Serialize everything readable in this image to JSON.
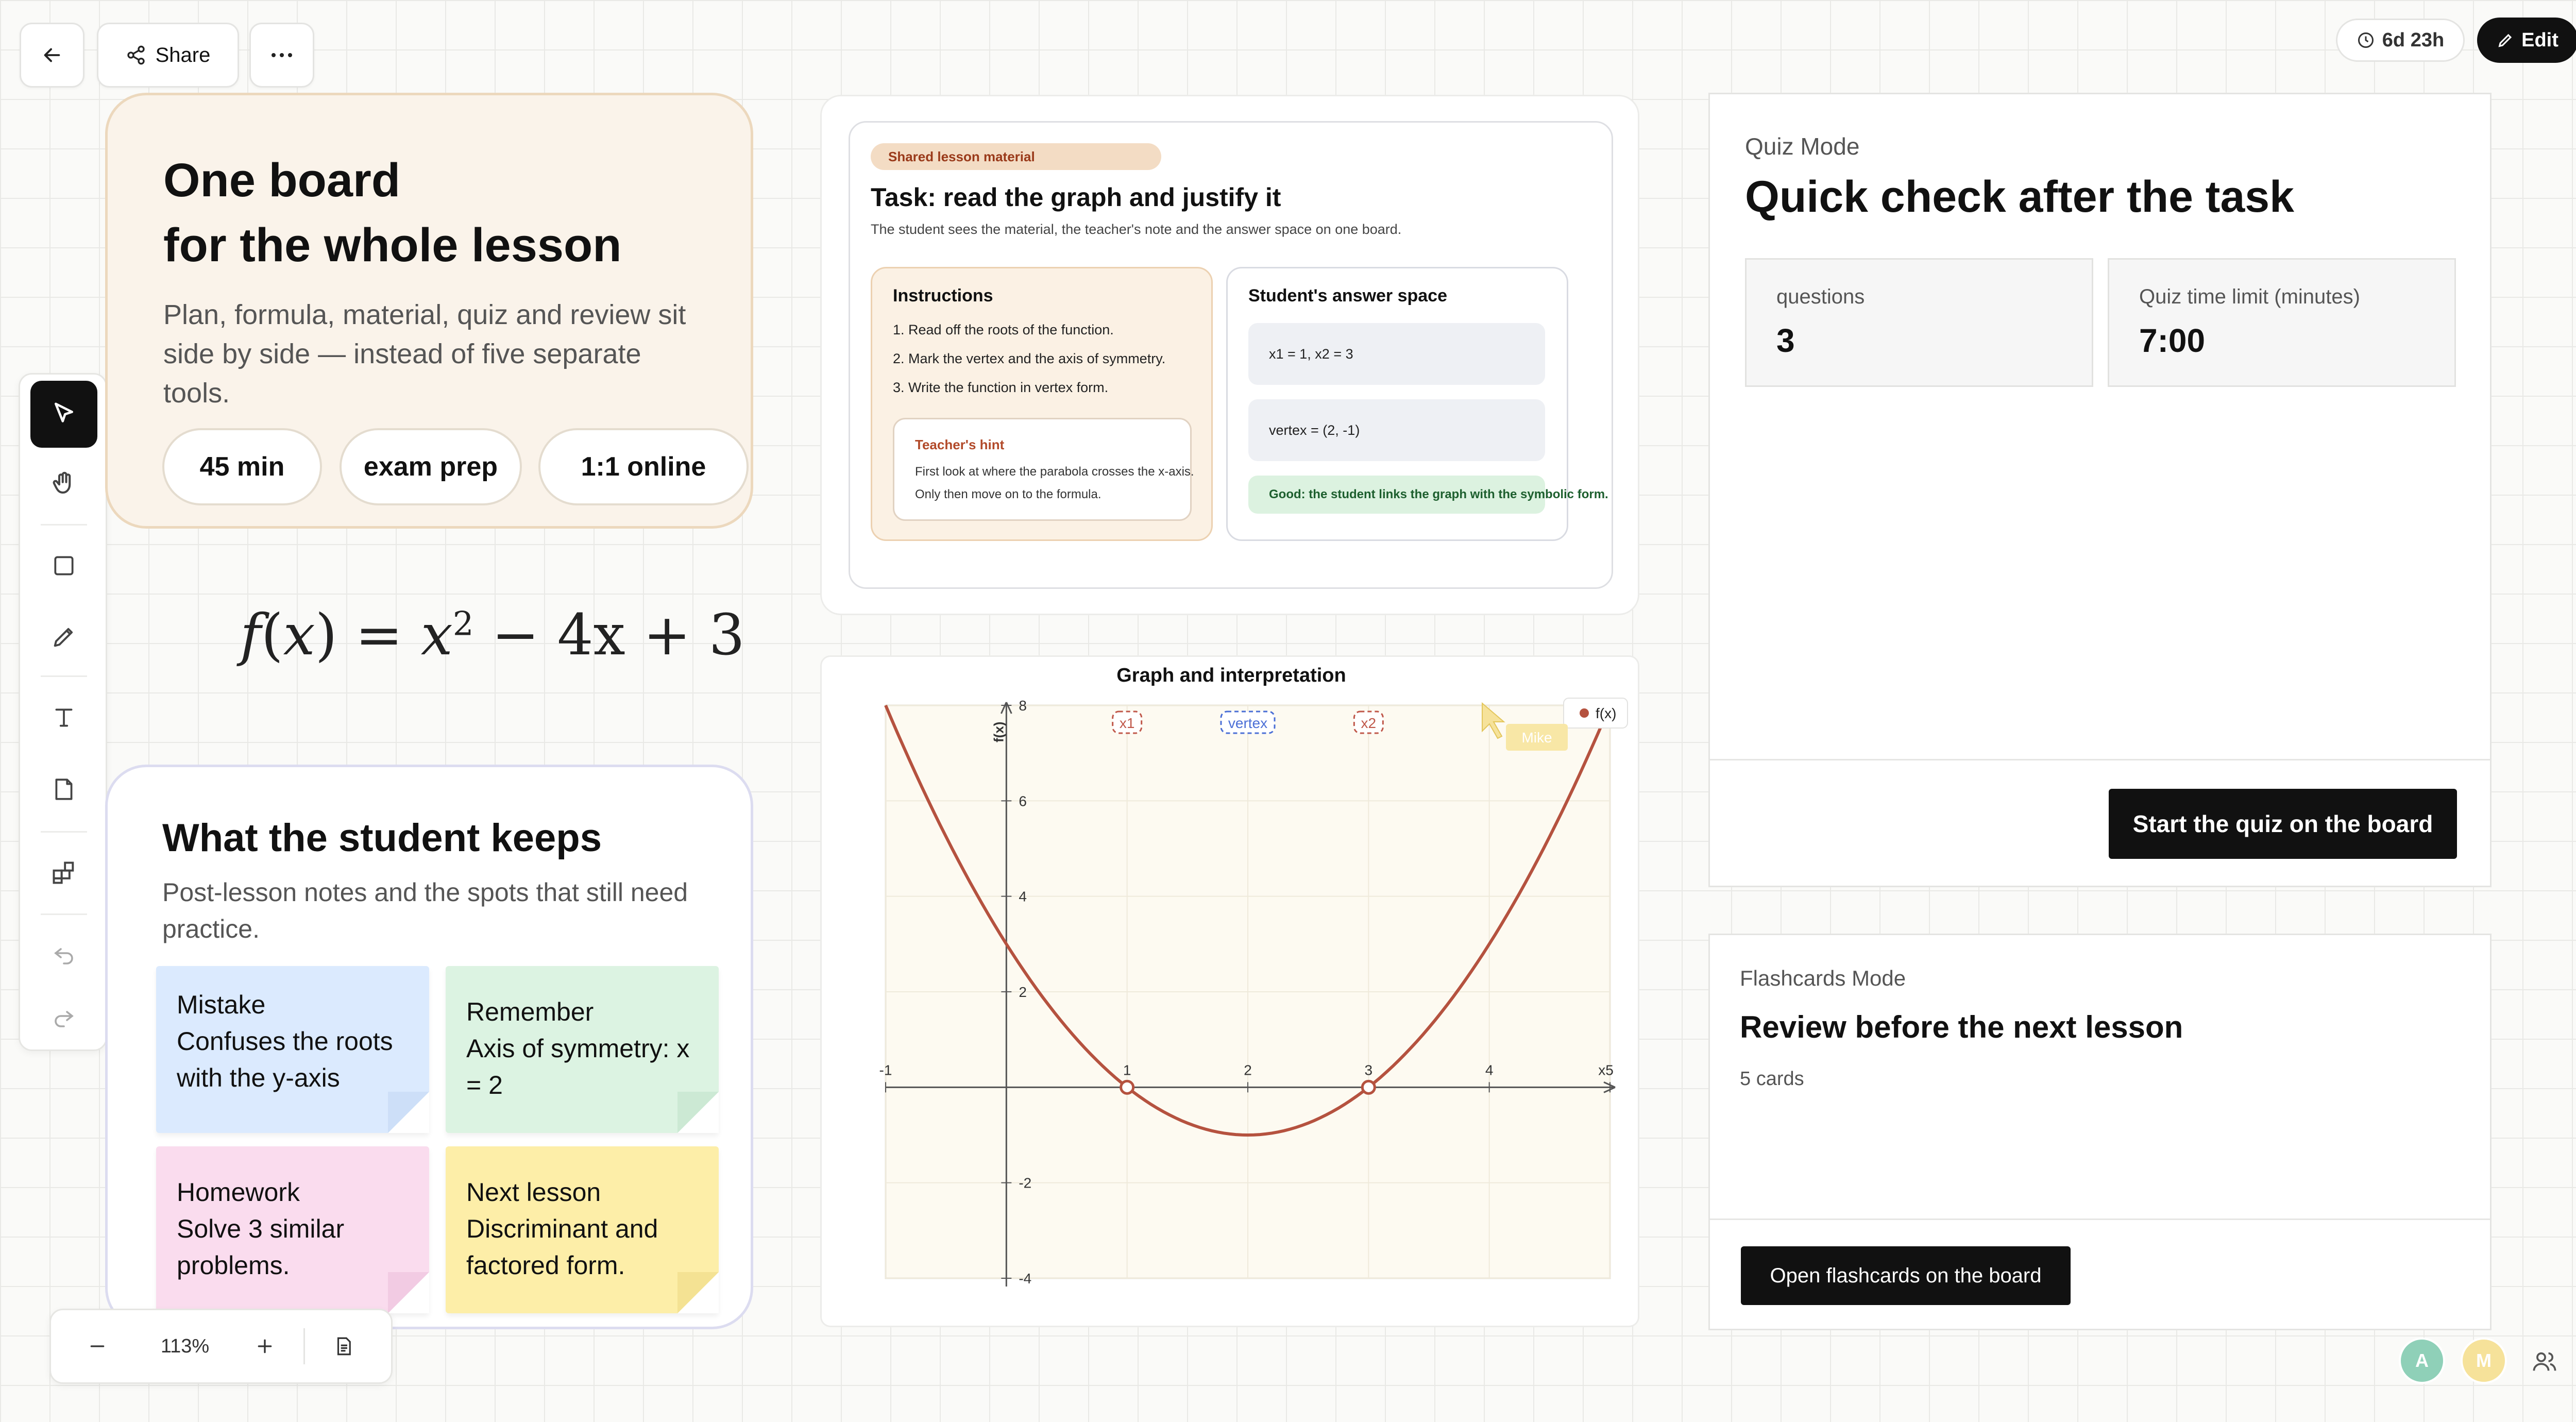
{
  "topbar": {
    "share_label": "Share",
    "timer_label": "6d 23h",
    "edit_label": "Edit"
  },
  "toolbar": {
    "tools": [
      "select",
      "hand",
      "rectangle",
      "pencil",
      "text",
      "sticky-note",
      "templates",
      "undo",
      "redo"
    ],
    "active": "select"
  },
  "zoom": {
    "level": "113%"
  },
  "lesson_card": {
    "title_line1": "One board",
    "title_line2": "for the whole lesson",
    "subtitle": "Plan, formula, material, quiz and review sit side by side — instead of five separate tools.",
    "chips": [
      "45 min",
      "exam prep",
      "1:1 online"
    ]
  },
  "formula": {
    "f": "f",
    "x": "x",
    "open": "(",
    "close": ")",
    "eq": " = ",
    "x2": "x",
    "exp": "2",
    "rest": " − 4x + 3"
  },
  "keeps_card": {
    "title": "What the student keeps",
    "subtitle": "Post-lesson notes and the spots that still need practice.",
    "notes": [
      {
        "heading": "Mistake",
        "text": "Confuses the roots with the y-axis",
        "color": "#dbeafe"
      },
      {
        "heading": "Remember",
        "text": "Axis of symmetry: x = 2",
        "color": "#dcf3e2"
      },
      {
        "heading": "Homework",
        "text": "Solve 3 similar problems.",
        "color": "#fadcee"
      },
      {
        "heading": "Next lesson",
        "text": "Discriminant and factored form.",
        "color": "#fdeea8"
      }
    ]
  },
  "material": {
    "tag": "Shared lesson material",
    "title": "Task: read the graph and justify it",
    "subtitle": "The student sees the material, the teacher's note and the answer space on one board.",
    "instructions_title": "Instructions",
    "instructions": [
      "1. Read off the roots of the function.",
      "2. Mark the vertex and the axis of symmetry.",
      "3. Write the function in vertex form."
    ],
    "hint_title": "Teacher's hint",
    "hint_text": "First look at where the parabola crosses the x-axis. Only then move on to the formula.",
    "answer_title": "Student's answer space",
    "answers": [
      "x1 = 1, x2 = 3",
      "vertex = (2, -1)"
    ],
    "feedback": "Good: the student links the graph with the symbolic form."
  },
  "graph": {
    "title": "Graph and interpretation",
    "ylabel": "f(x)",
    "legend": "f(x)",
    "cursor_name": "Mike",
    "labels": {
      "x1": "x1",
      "vertex": "vertex",
      "x2": "x2"
    },
    "x_ticks": [
      "-1",
      "1",
      "2",
      "3",
      "4",
      "x5"
    ],
    "y_ticks": [
      "8",
      "6",
      "4",
      "2",
      "-2",
      "-4"
    ],
    "curve_color": "#b5523f"
  },
  "chart_data": {
    "type": "line",
    "title": "Graph and interpretation",
    "ylabel": "f(x)",
    "xlim": [
      -1,
      5
    ],
    "ylim": [
      -4,
      8
    ],
    "series": [
      {
        "name": "f(x)",
        "function": "x^2 - 4x + 3",
        "x": [
          -1,
          0,
          1,
          2,
          3,
          4,
          5
        ],
        "y": [
          8,
          3,
          0,
          -1,
          0,
          3,
          8
        ]
      }
    ],
    "marked_points": [
      {
        "label": "x1",
        "x": 1,
        "y": 0
      },
      {
        "label": "x2",
        "x": 3,
        "y": 0
      }
    ],
    "grid": true,
    "legend": "top-right"
  },
  "quiz": {
    "mode_label": "Quiz Mode",
    "title": "Quick check after the task",
    "questions_label": "questions",
    "questions_value": "3",
    "time_label": "Quiz time limit (minutes)",
    "time_value": "7:00",
    "start_button": "Start the quiz on the board"
  },
  "flashcards": {
    "mode_label": "Flashcards Mode",
    "title": "Review before the next lesson",
    "count": "5 cards",
    "open_button": "Open flashcards on the board"
  },
  "avatars": [
    {
      "letter": "A",
      "color": "#8fd0b8"
    },
    {
      "letter": "M",
      "color": "#f6e29a"
    }
  ]
}
